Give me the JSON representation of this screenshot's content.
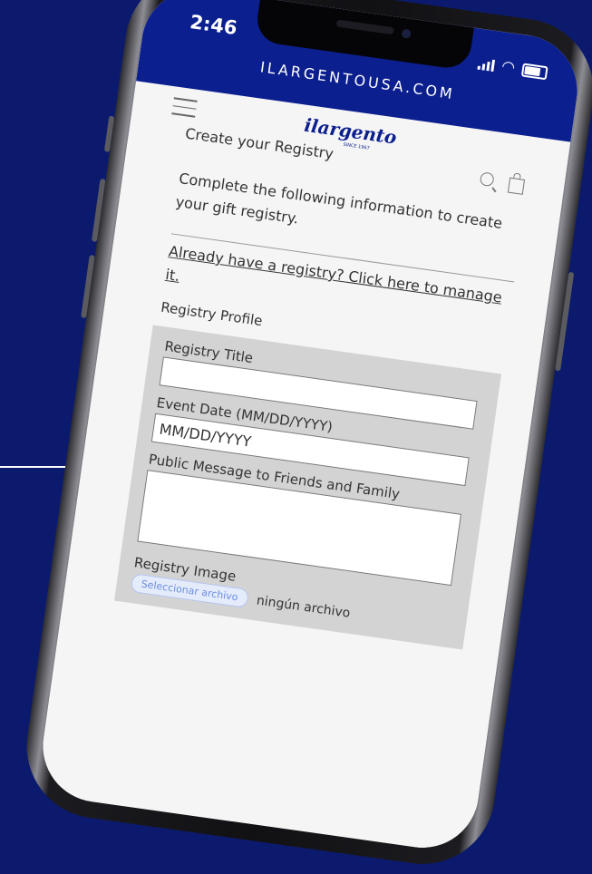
{
  "status_bar": {
    "time": "2:46",
    "url": "ILARGENTOUSA.COM"
  },
  "header": {
    "logo_text": "ilargento",
    "logo_tagline": "SINCE 1967",
    "icons": [
      "hamburger-icon",
      "search-icon",
      "shopping-bag-icon"
    ]
  },
  "page": {
    "title": "Create your Registry",
    "intro": "Complete the following information to create your gift registry.",
    "manage_link": "Already have a registry? Click here to manage it."
  },
  "form": {
    "section_title": "Registry Profile",
    "registry_title_label": "Registry Title",
    "registry_title_value": "",
    "event_date_label": "Event Date (MM/DD/YYYY)",
    "event_date_placeholder": "MM/DD/YYYY",
    "public_message_label": "Public Message to Friends and Family",
    "registry_image_label": "Registry Image",
    "file_button_label": "Seleccionar archivo",
    "file_status": "ningún archivo"
  },
  "colors": {
    "background": "#0c1a6e",
    "brand_blue": "#0c1f8f",
    "form_panel": "#d3d3d3"
  }
}
